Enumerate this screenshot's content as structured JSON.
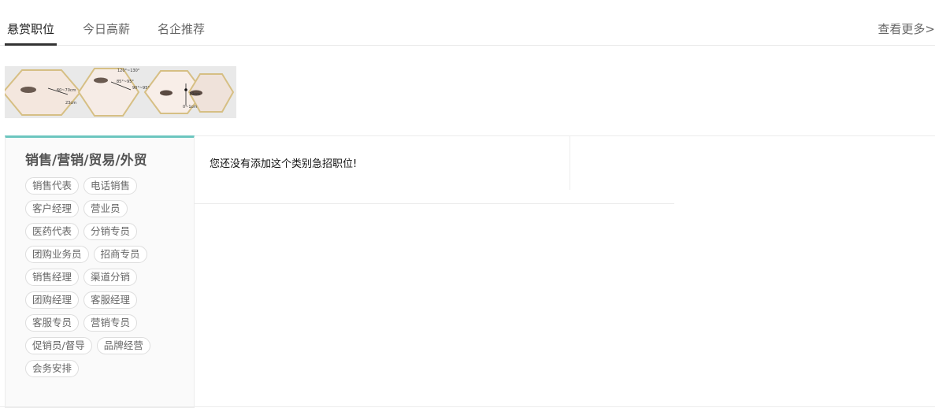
{
  "tabs": [
    {
      "label": "悬赏职位",
      "active": true
    },
    {
      "label": "今日高薪",
      "active": false
    },
    {
      "label": "名企推荐",
      "active": false
    }
  ],
  "more_label": "查看更多>",
  "banner": {
    "labels": [
      "120°~130°",
      "60~70cm",
      "85°~95°",
      "90°~95°",
      "23cm",
      "10cm",
      "0~1cm"
    ]
  },
  "category": {
    "title": "销售/营销/贸易/外贸",
    "chip_rows": [
      [
        "销售代表",
        "电话销售"
      ],
      [
        "客户经理",
        "营业员"
      ],
      [
        "医药代表",
        "分销专员"
      ],
      [
        "团购业务员",
        "招商专员"
      ],
      [
        "销售经理",
        "渠道分销"
      ],
      [
        "团购经理",
        "客服经理"
      ],
      [
        "客服专员",
        "营销专员"
      ],
      [
        "促销员/督导",
        "品牌经营"
      ],
      [
        "会务安排"
      ]
    ]
  },
  "empty_message": "您还没有添加这个类别急招职位!",
  "colors": {
    "accent": "#6cc6bf",
    "active_tab": "#333333",
    "border": "#ececec"
  }
}
